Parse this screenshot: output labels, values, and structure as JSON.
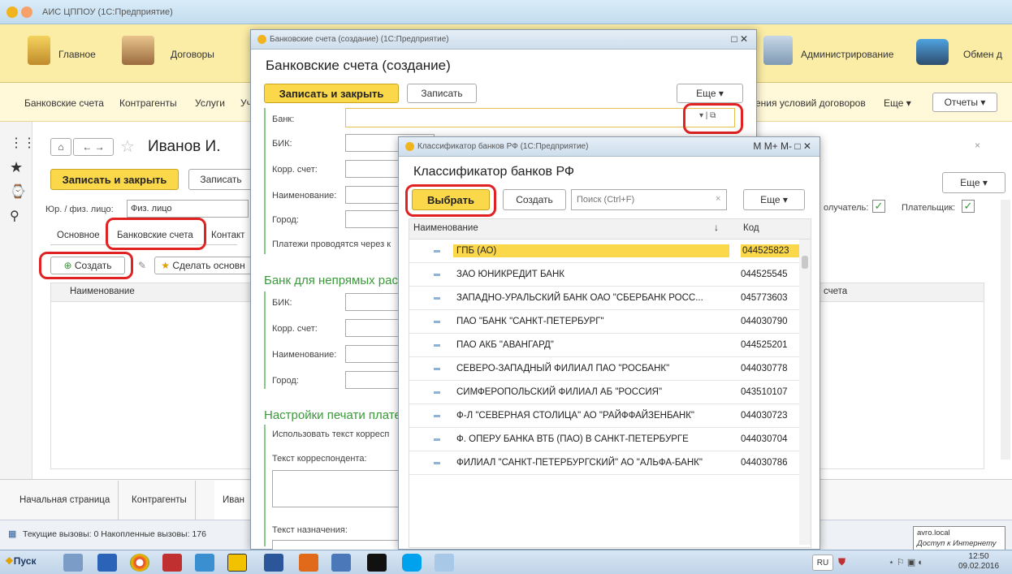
{
  "main_title": "АИС ЦППОУ  (1С:Предприятие)",
  "top_sections": [
    "Главное",
    "Договоры",
    "Администрирование",
    "Обмен д"
  ],
  "nav_items": [
    "Банковские счета",
    "Контрагенты",
    "Услуги",
    "Уч"
  ],
  "nav_right": {
    "conditions": "ения условий договоров",
    "more": "Еще ▾",
    "reports": "Отчеты ▾"
  },
  "doc": {
    "title": "Иванов И.",
    "save_close": "Записать и закрыть",
    "save": "Записать",
    "more": "Еще",
    "legal_label": "Юр. / физ. лицо:",
    "legal_value": "Физ. лицо",
    "recipient": "олучатель:",
    "payer": "Плательщик:",
    "tabs": [
      "Основное",
      "Банковские счета",
      "Контакт"
    ],
    "create": "Создать",
    "make_main": "Сделать основн",
    "col_name": "Наименование",
    "col_account": "счета"
  },
  "bottom_tabs": [
    "Начальная страница",
    "Контрагенты",
    "Иван"
  ],
  "status_text": "Текущие вызовы: 0  Накопленные вызовы: 176",
  "accounts": {
    "window_title": "Банковские счета (создание)  (1С:Предприятие)",
    "title": "Банковские счета (создание)",
    "save_close": "Записать и закрыть",
    "save": "Записать",
    "more": "Еще",
    "bank": "Банк:",
    "bik": "БИК:",
    "corr": "Корр. счет:",
    "name": "Наименование:",
    "city": "Город:",
    "payments": "Платежи проводятся через к",
    "indirect": "Банк для непрямых рас",
    "bik2": "БИК:",
    "corr2": "Корр. счет:",
    "name2": "Наименование:",
    "city2": "Город:",
    "print_settings": "Настройки печати плате",
    "use_text": "Использовать текст корресп",
    "corr_text": "Текст корреспондента:",
    "purpose_text": "Текст назначения:"
  },
  "classifier": {
    "window_title": "Классификатор банков РФ  (1С:Предприятие)",
    "title": "Классификатор банков РФ",
    "choose": "Выбрать",
    "create": "Создать",
    "search_placeholder": "Поиск (Ctrl+F)",
    "more": "Еще",
    "col_name": "Наименование",
    "col_code": "Код",
    "rows": [
      {
        "name": "ГПБ (АО)",
        "code": "044525823"
      },
      {
        "name": "ЗАО ЮНИКРЕДИТ БАНК",
        "code": "044525545"
      },
      {
        "name": "ЗАПАДНО-УРАЛЬСКИЙ БАНК ОАО \"СБЕРБАНК РОСС...",
        "code": "045773603"
      },
      {
        "name": "ПАО \"БАНК \"САНКТ-ПЕТЕРБУРГ\"",
        "code": "044030790"
      },
      {
        "name": "ПАО АКБ \"АВАНГАРД\"",
        "code": "044525201"
      },
      {
        "name": "СЕВЕРО-ЗАПАДНЫЙ ФИЛИАЛ ПАО \"РОСБАНК\"",
        "code": "044030778"
      },
      {
        "name": "СИМФЕРОПОЛЬСКИЙ ФИЛИАЛ АБ \"РОССИЯ\"",
        "code": "043510107"
      },
      {
        "name": "Ф-Л \"СЕВЕРНАЯ СТОЛИЦА\" АО \"РАЙФФАЙЗЕНБАНК\"",
        "code": "044030723"
      },
      {
        "name": "Ф. ОПЕРУ БАНКА ВТБ (ПАО) В САНКТ-ПЕТЕРБУРГЕ",
        "code": "044030704"
      },
      {
        "name": "ФИЛИАЛ \"САНКТ-ПЕТЕРБУРГСКИЙ\" АО \"АЛЬФА-БАНК\"",
        "code": "044030786"
      }
    ]
  },
  "taskbar": {
    "start": "Пуск",
    "lang": "RU",
    "host": "avro.local",
    "net": "Доступ к Интернету",
    "time": "12:50",
    "date": "09.02.2016"
  },
  "colors": {
    "accent_yellow": "#fbd84a",
    "top_bg": "#fbeda6",
    "selected_row": "#fbd84a",
    "highlight": "#e02222"
  }
}
